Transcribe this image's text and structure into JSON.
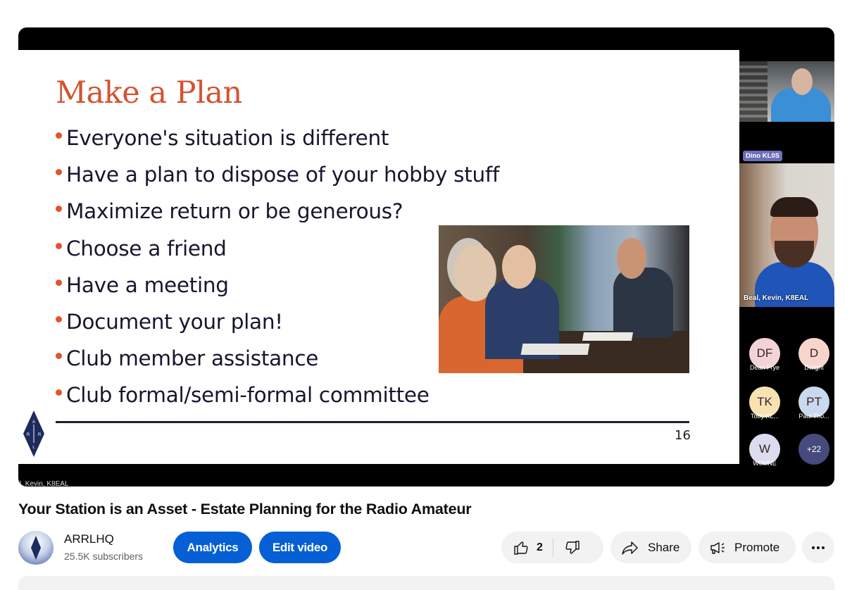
{
  "player": {
    "slide": {
      "title": "Make a Plan",
      "bullets": [
        "Everyone's situation is different",
        "Have a plan to dispose of your hobby stuff",
        "Maximize return or be generous?",
        "Choose a friend",
        "Have a meeting",
        "Document your plan!",
        "Club member assistance",
        "Club formal/semi-formal committee"
      ],
      "page_number": "16",
      "logo_letters": [
        "A",
        "R",
        "R",
        "L"
      ],
      "photo_alt": "meeting-photo"
    },
    "participants": {
      "video_tiles": [
        {
          "name": "Dino KL0S"
        },
        {
          "name": "Beal, Kevin, K8EAL"
        }
      ],
      "avatars": [
        {
          "initials": "DF",
          "name": "Dean Frye",
          "color": "#f2d3d6"
        },
        {
          "initials": "D",
          "name": "Dwight",
          "color": "#f7d5cd"
        },
        {
          "initials": "TK",
          "name": "Toby KL...",
          "color": "#f8e2b4"
        },
        {
          "initials": "PT",
          "name": "Paul Tho...",
          "color": "#c9d9ee"
        },
        {
          "initials": "W",
          "name": "W0MNE",
          "color": "#dcdcef"
        },
        {
          "initials": "+22",
          "name": "",
          "color": "#464a7c"
        }
      ]
    },
    "bottom_overlay_name": "l, Kevin, K8EAL"
  },
  "video": {
    "title": "Your Station is an Asset - Estate Planning for the Radio Amateur"
  },
  "channel": {
    "name": "ARRLHQ",
    "subscribers": "25.5K subscribers"
  },
  "actions": {
    "analytics": "Analytics",
    "edit_video": "Edit video",
    "like_count": "2",
    "share": "Share",
    "promote": "Promote"
  },
  "colors": {
    "accent_blue": "#065fd4",
    "slide_title": "#d4532f",
    "bullet_dot": "#e3532d"
  }
}
